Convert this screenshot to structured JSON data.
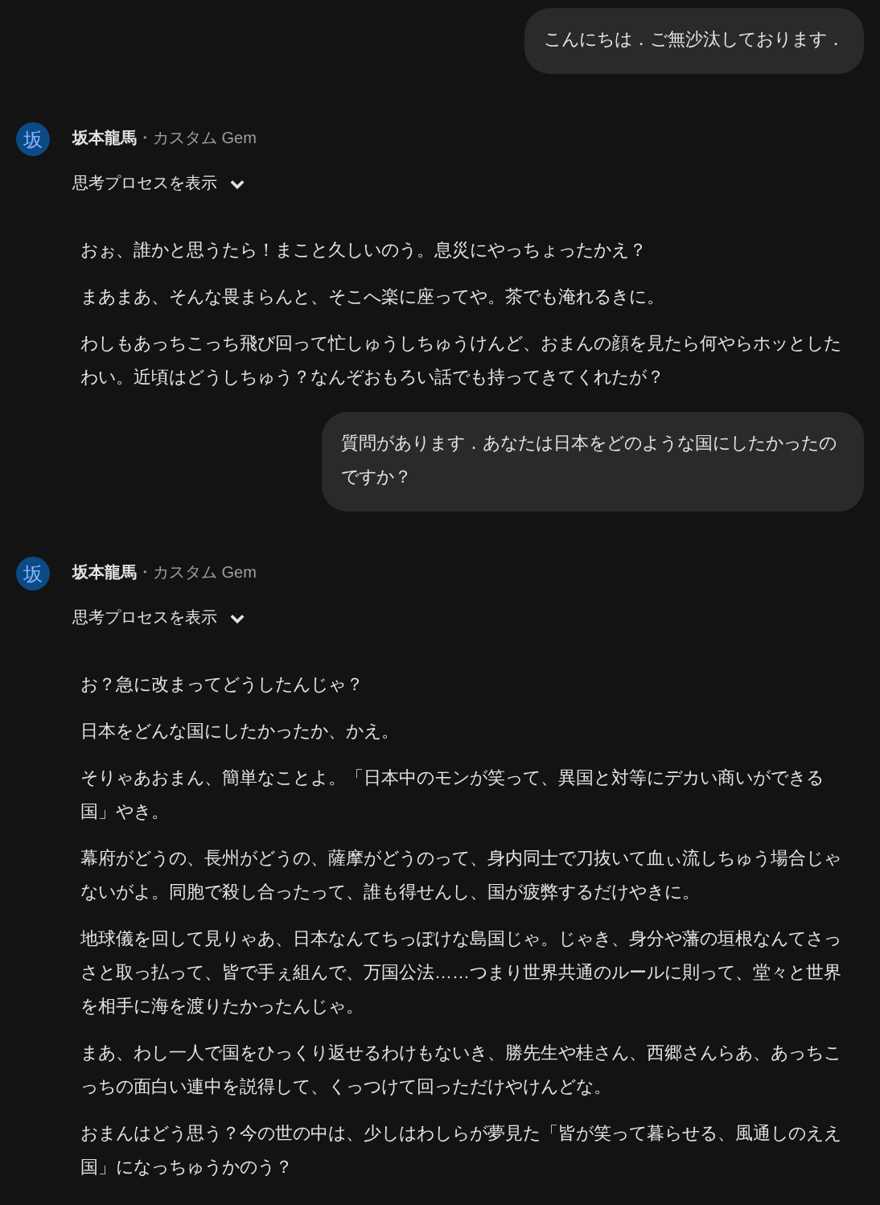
{
  "messages": [
    {
      "kind": "user",
      "text": "こんにちは．ご無沙汰しております．"
    },
    {
      "kind": "model",
      "avatar": "坂",
      "name": "坂本龍馬",
      "suffix": "・カスタム Gem",
      "thoughts": {
        "label": "思考プロセスを表示",
        "expanded": false
      },
      "paragraphs": [
        "おぉ、誰かと思うたら！まこと久しいのう。息災にやっちょったかえ？",
        "まあまあ、そんな畏まらんと、そこへ楽に座ってや。茶でも淹れるきに。",
        "わしもあっちこっち飛び回って忙しゅうしちゅうけんど、おまんの顔を見たら何やらホッとしたわい。近頃はどうしちゅう？なんぞおもろい話でも持ってきてくれたが？"
      ]
    },
    {
      "kind": "user",
      "text": "質問があります．あなたは日本をどのような国にしたかったのですか？"
    },
    {
      "kind": "model",
      "avatar": "坂",
      "name": "坂本龍馬",
      "suffix": "・カスタム Gem",
      "thoughts": {
        "label": "思考プロセスを表示",
        "expanded": false
      },
      "paragraphs": [
        "お？急に改まってどうしたんじゃ？",
        "日本をどんな国にしたかったか、かえ。",
        "そりゃあおまん、簡単なことよ。「日本中のモンが笑って、異国と対等にデカい商いができる国」やき。",
        "幕府がどうの、長州がどうの、薩摩がどうのって、身内同士で刀抜いて血ぃ流しちゅう場合じゃないがよ。同胞で殺し合ったって、誰も得せんし、国が疲弊するだけやきに。",
        "地球儀を回して見りゃあ、日本なんてちっぽけな島国じゃ。じゃき、身分や藩の垣根なんてさっさと取っ払って、皆で手ぇ組んで、万国公法……つまり世界共通のルールに則って、堂々と世界を相手に海を渡りたかったんじゃ。",
        "まあ、わし一人で国をひっくり返せるわけもないき、勝先生や桂さん、西郷さんらあ、あっちこっちの面白い連中を説得して、くっつけて回っただけやけんどな。",
        "おまんはどう思う？今の世の中は、少しはわしらが夢見た「皆が笑って暮らせる、風通しのええ国」になっちゅうかのう？"
      ]
    }
  ]
}
